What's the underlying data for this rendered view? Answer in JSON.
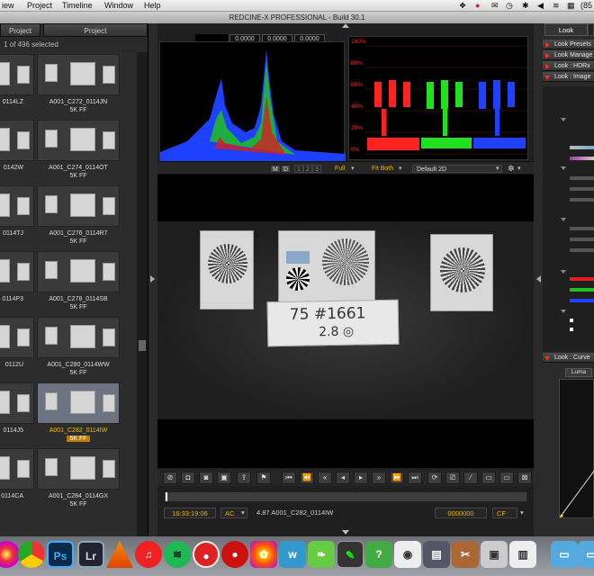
{
  "menubar": {
    "items": [
      "iew",
      "Project",
      "Timeline",
      "Window",
      "Help"
    ],
    "battery": "(85"
  },
  "app_title": "REDCINE-X PROFESSIONAL - Build 30.1",
  "project_panel": {
    "col_left": "Project",
    "col_right": "Project",
    "selection": "1 of 496 selected",
    "clips": [
      {
        "name": "0114LZ",
        "format": ""
      },
      {
        "name": "A001_C272_0114JN",
        "format": "5K FF"
      },
      {
        "name": "0142W",
        "format": ""
      },
      {
        "name": "A001_C274_0114OT",
        "format": "5K FF"
      },
      {
        "name": "0114TJ",
        "format": ""
      },
      {
        "name": "A001_C276_0114R7",
        "format": "5K FF"
      },
      {
        "name": "0114P3",
        "format": ""
      },
      {
        "name": "A001_C278_0114SB",
        "format": "5K FF"
      },
      {
        "name": "0112U",
        "format": ""
      },
      {
        "name": "A001_C280_0114WW",
        "format": "5K FF"
      },
      {
        "name": "0114J5",
        "format": ""
      },
      {
        "name": "A001_C282_0114IW",
        "format": "5K FF"
      },
      {
        "name": "0114CA",
        "format": ""
      },
      {
        "name": "A001_C284_0114GX",
        "format": "5K FF"
      }
    ]
  },
  "scopes": {
    "values": [
      "0.0000",
      "0.0000",
      "0.0000"
    ],
    "rgb_ticks": [
      "100%",
      "80%",
      "60%",
      "40%",
      "20%",
      "0%"
    ],
    "colors": {
      "red": "#ff2020",
      "green": "#20e020",
      "blue": "#2040ff"
    }
  },
  "viewer_toolbar": {
    "m": "M",
    "d": "D",
    "n1": "1",
    "n2": "2",
    "n3": "3",
    "quality": "Full",
    "fit": "Fit Both",
    "lut": "Default 2D"
  },
  "slate": {
    "line1": "75 #1661",
    "line2": "2.8 ◎"
  },
  "transport": {
    "buttons": [
      "camera-off",
      "camera",
      "add-frame",
      "rsd",
      "export",
      "flag",
      "go-start",
      "step-back-fast",
      "rewind",
      "step-back",
      "play",
      "step-fwd",
      "fast-fwd",
      "go-end",
      "loop"
    ]
  },
  "status": {
    "timecode": "16:33:19:06",
    "mode": "AC",
    "clip_info": "4.87 A001_C282_0114IW",
    "frame": "0000000",
    "cf": "CF"
  },
  "look_panel": {
    "tab_active": "Look",
    "sections": [
      "Look Presets",
      "Look Manage",
      "Look : HDRx",
      "Look : Image",
      "Look : Curve"
    ],
    "luma_tab": "Luma",
    "accent": "#e8b400"
  }
}
